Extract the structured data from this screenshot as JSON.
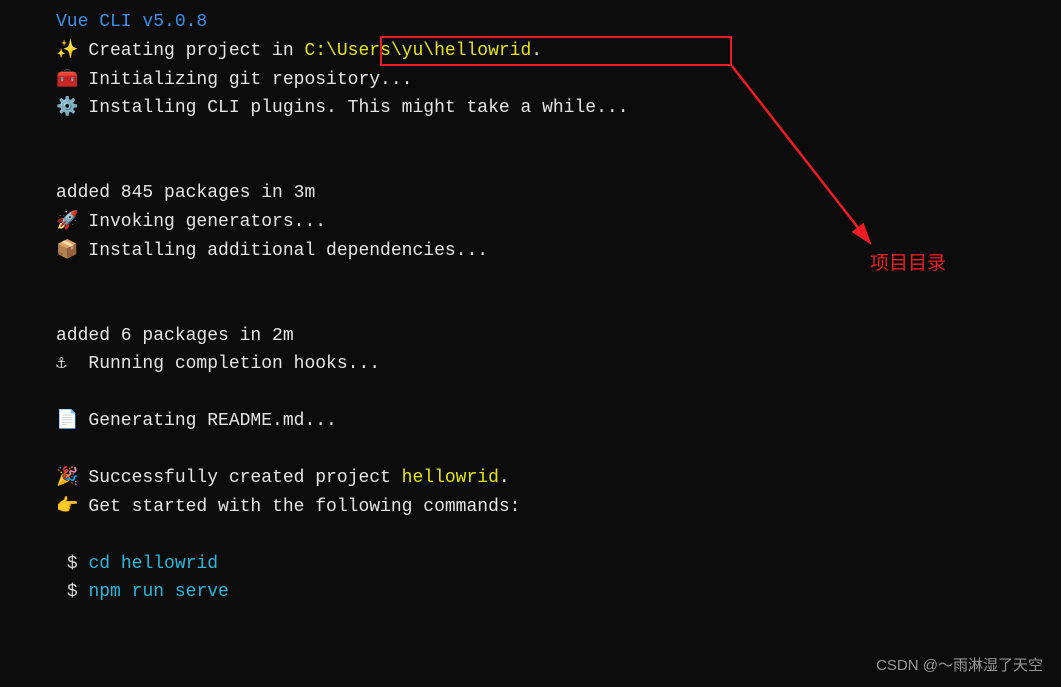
{
  "header": {
    "title": "Vue CLI v5.0.8"
  },
  "lines": {
    "creating_prefix": "Creating project in ",
    "creating_path": "C:\\Users\\yu\\hellowrid",
    "creating_suffix": ".",
    "init_git": "Initializing git repository...",
    "install_plugins": "Installing CLI plugins. This might take a while...",
    "added1": "added 845 packages in 3m",
    "invoking": "Invoking generators...",
    "install_deps": "Installing additional dependencies...",
    "added2": "added 6 packages in 2m",
    "completion": "Running completion hooks...",
    "readme": "Generating README.md...",
    "success_prefix": "Successfully created project ",
    "success_project": "hellowrid",
    "success_suffix": ".",
    "getstarted": "Get started with the following commands:",
    "prompt": "$",
    "cmd1": "cd hellowrid",
    "cmd2": "npm run serve"
  },
  "icons": {
    "sparkle": "✨",
    "toolbox": "🧰",
    "gear": "⚙️",
    "rocket": "🚀",
    "package": "📦",
    "anchor": "⚓",
    "document": "📄",
    "confetti": "🎉",
    "pointer": "👉"
  },
  "annotation": {
    "label": "项目目录"
  },
  "watermark": {
    "text": "CSDN @～雨淋湿了天空"
  }
}
